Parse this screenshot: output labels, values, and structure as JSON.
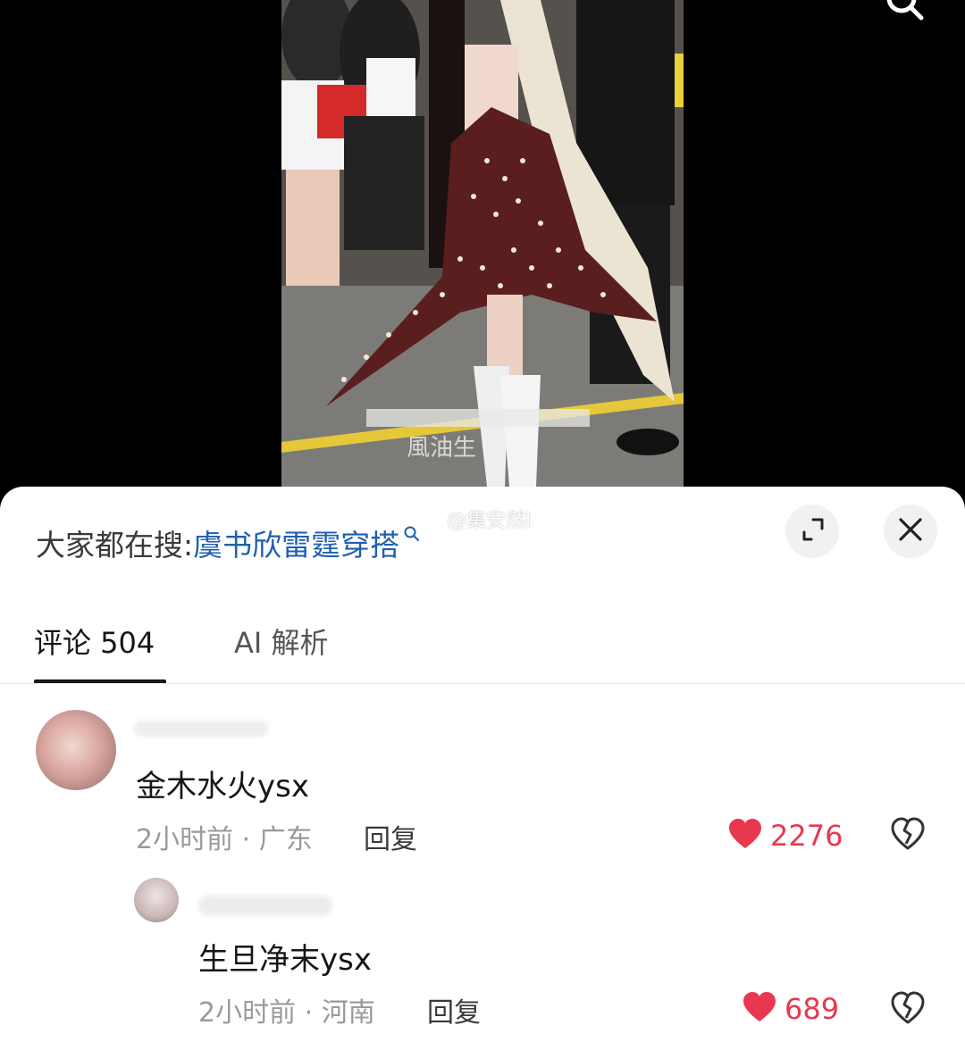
{
  "watermark": "@集安然l",
  "search_suggest": {
    "prefix": "大家都在搜:",
    "term": "虞书欣雷霆穿搭"
  },
  "tabs": [
    {
      "label": "评论 504",
      "active": true
    },
    {
      "label": "AI 解析",
      "active": false
    }
  ],
  "comments": [
    {
      "text": "金木水火ysx",
      "meta": "2小时前 · 广东",
      "reply_label": "回复",
      "likes": "2276"
    },
    {
      "text": "生旦净末ysx",
      "meta": "2小时前 · 河南",
      "reply_label": "回复",
      "likes": "689"
    }
  ],
  "colors": {
    "link": "#1f5fb0",
    "like": "#e8384f"
  },
  "icons": [
    "search-icon",
    "expand-icon",
    "close-icon",
    "heart-icon",
    "broken-heart-icon"
  ]
}
